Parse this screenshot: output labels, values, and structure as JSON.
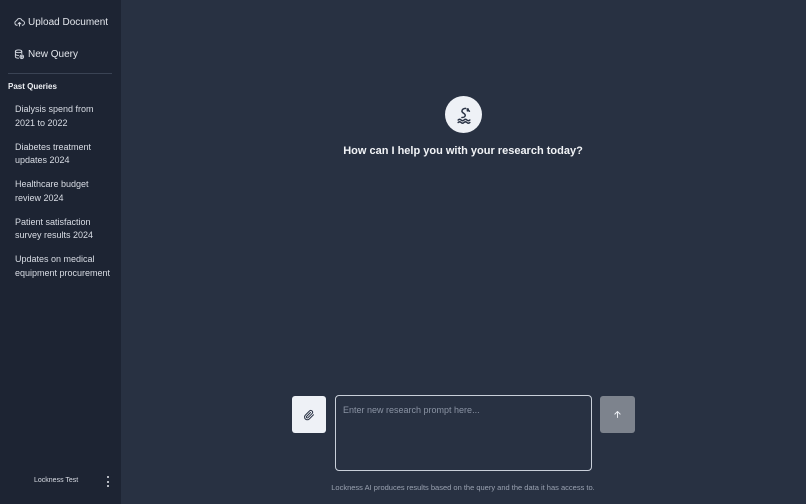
{
  "sidebar": {
    "upload_label": "Upload Document",
    "upload_icon": "cloud-upload-icon",
    "new_query_label": "New Query",
    "new_query_icon": "database-plus-icon",
    "past_title": "Past Queries",
    "past_queries": [
      "Dialysis spend from 2021 to 2022",
      "Diabetes treatment updates 2024",
      "Healthcare budget review 2024",
      "Patient satisfaction survey results 2024",
      "Updates on medical equipment procurement"
    ],
    "user_name": "Lockness Test",
    "menu_icon": "more-vertical-icon"
  },
  "main": {
    "logo_icon": "lockness-logo-icon",
    "headline": "How can I help you with your research today?",
    "prompt_placeholder": "Enter new research prompt here...",
    "prompt_value": "",
    "attach_icon": "paperclip-icon",
    "send_icon": "arrow-up-icon",
    "disclaimer": "Lockness AI produces results based on the query and the data it has access to."
  },
  "colors": {
    "background": "#283142",
    "sidebar": "#1d2433",
    "send_button_disabled": "#7d838d",
    "button_light": "#eef1f6"
  }
}
